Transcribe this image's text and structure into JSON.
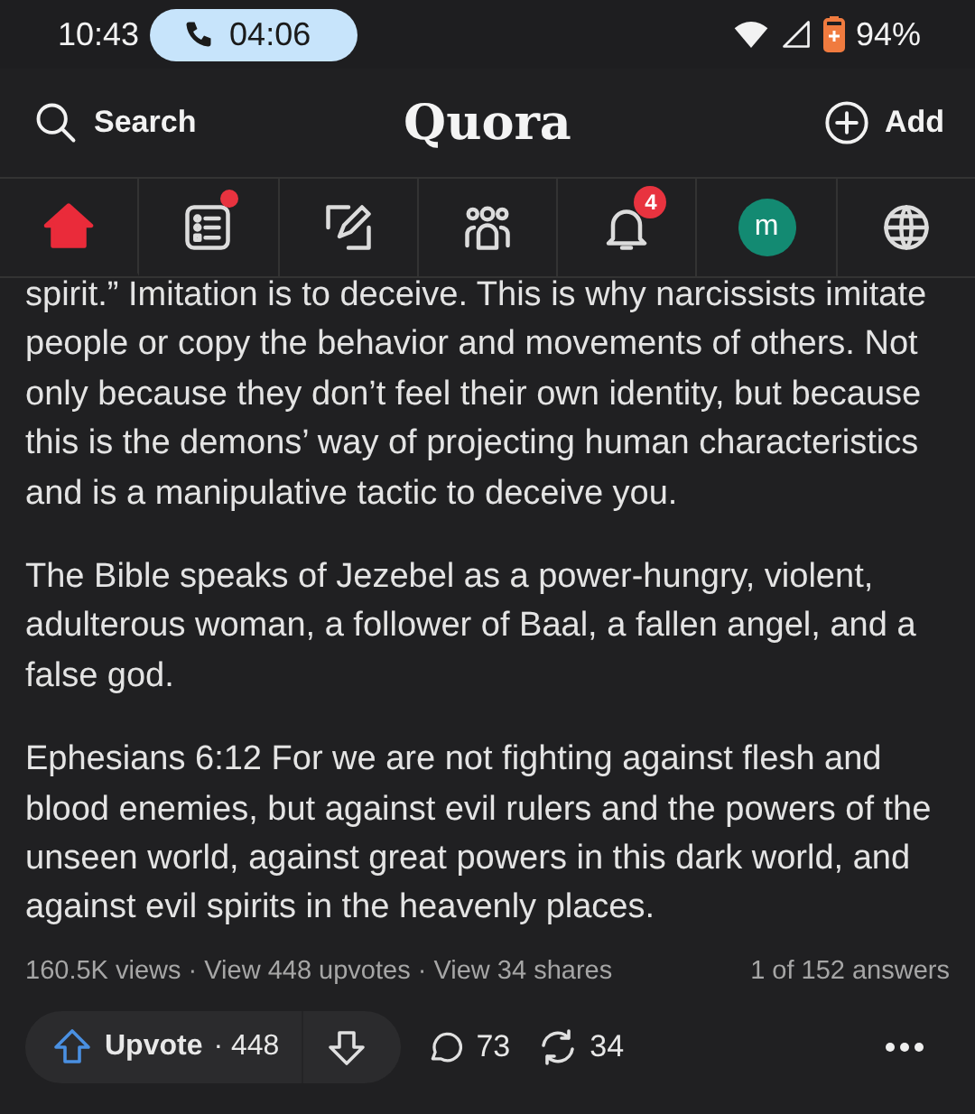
{
  "status_bar": {
    "time": "10:43",
    "call_timer": "04:06",
    "battery": "94%"
  },
  "header": {
    "search_label": "Search",
    "logo": "Quora",
    "add_label": "Add"
  },
  "tabs": [
    {
      "kind": "home",
      "selected": true,
      "notification_dot": false
    },
    {
      "kind": "following",
      "selected": false,
      "notification_dot": true
    },
    {
      "kind": "answer",
      "selected": false,
      "notification_dot": false
    },
    {
      "kind": "spaces",
      "selected": false,
      "notification_dot": false
    },
    {
      "kind": "notifications",
      "selected": false,
      "notification_dot": false,
      "badge": "4"
    },
    {
      "kind": "profile",
      "selected": false,
      "notification_dot": false,
      "avatar_letter": "m"
    },
    {
      "kind": "languages",
      "selected": false,
      "notification_dot": false
    }
  ],
  "paragraphs": [
    "spirit.” Imitation is to deceive. This is why narcissists imitate people or copy the behavior and movements of others. Not only because they don’t feel their own identity, but because this is the demons’ way of projecting human characteristics and is a manipulative tactic to deceive you.",
    "The Bible speaks of Jezebel as a power-hungry, violent, adulterous woman, a follower of Baal, a fallen angel, and a false god.",
    "Ephesians 6:12 For we are not fighting against flesh and blood enemies, but against evil rulers and the powers of the unseen world, against great powers in this dark world, and against evil spirits in the heavenly places."
  ],
  "stats": {
    "summary": "160.5K views · View 448 upvotes · View 34 shares",
    "position": "1 of 152 answers"
  },
  "actions": {
    "upvote_label": "Upvote",
    "upvote_count": "· 448",
    "comments": "73",
    "shares": "34"
  }
}
